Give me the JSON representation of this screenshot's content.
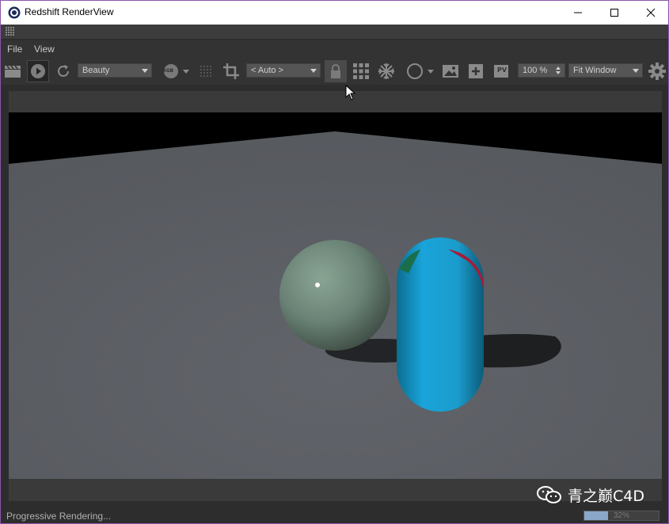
{
  "window": {
    "title": "Redshift RenderView",
    "minimize_icon": "minimize-icon",
    "maximize_icon": "maximize-icon",
    "close_icon": "close-icon"
  },
  "menu": {
    "items": [
      {
        "label": "File"
      },
      {
        "label": "View"
      }
    ]
  },
  "toolbar": {
    "aov_select": {
      "value": "Beauty"
    },
    "channel_label": "RGB",
    "region_select": {
      "value": "< Auto >"
    },
    "zoom": {
      "value": "100 %"
    },
    "fit_select": {
      "value": "Fit Window"
    },
    "icons": [
      "clapperboard-icon",
      "play-icon",
      "refresh-icon",
      "rgb-icon",
      "grid-dots-icon",
      "crop-icon",
      "lock-icon",
      "grid-icon",
      "snowflake-icon",
      "circle-icon",
      "image-icon",
      "add-snapshot-icon",
      "pv-icon",
      "gear-icon"
    ],
    "pv_label": "PV"
  },
  "status": {
    "text": "Progressive Rendering...",
    "progress_label": "32%",
    "progress": 0.32
  },
  "watermark": {
    "text": "青之巅C4D",
    "icon": "wechat-icon"
  },
  "colors": {
    "accent": "#8aa6c8",
    "sphere": "#6f8a7c",
    "capsule": "#1aa0d6",
    "floor": "#5a5d62",
    "border": "#8a56a8"
  }
}
